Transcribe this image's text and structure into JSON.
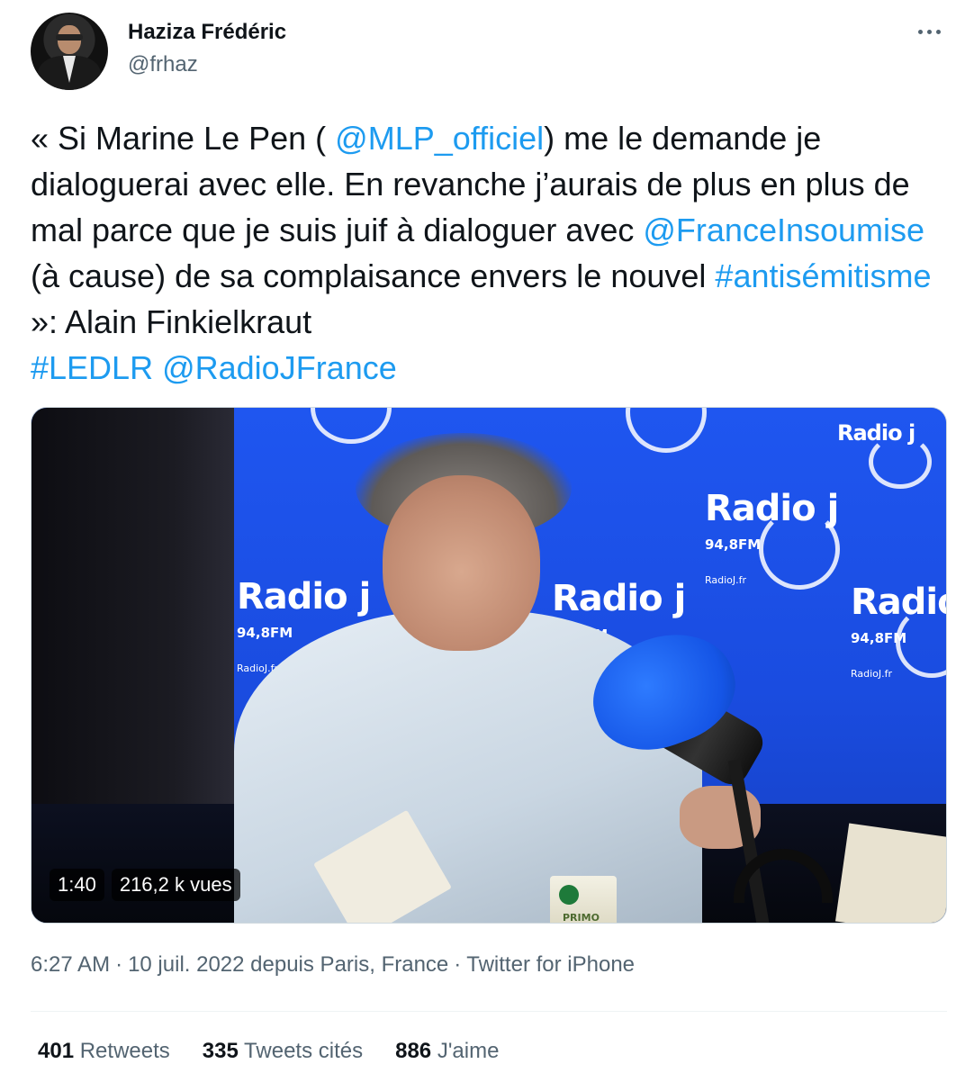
{
  "author": {
    "name": "Haziza Frédéric",
    "handle": "@frhaz"
  },
  "tweet": {
    "text_segments": [
      {
        "text": "« Si Marine Le Pen ( ",
        "type": "text"
      },
      {
        "text": "@MLP_officiel",
        "type": "mention"
      },
      {
        "text": ") me le demande je dialoguerai avec elle. En revanche j’aurais de plus en plus de mal parce que je suis juif à dialoguer avec ",
        "type": "text"
      },
      {
        "text": "@FranceInsoumise",
        "type": "mention"
      },
      {
        "text": " (à cause) de sa complaisance envers le nouvel ",
        "type": "text"
      },
      {
        "text": "#antisémitisme",
        "type": "hashtag"
      },
      {
        "text": " »: Alain Finkielkraut ",
        "type": "text"
      },
      {
        "text": "#LEDLR",
        "type": "hashtag"
      },
      {
        "text": " ",
        "type": "text"
      },
      {
        "text": "@RadioJFrance",
        "type": "mention"
      }
    ]
  },
  "media": {
    "duration": "1:40",
    "views": "216,2 k vues",
    "logos": {
      "brand": "Radio",
      "brand_letter": "j",
      "frequency": "94,8FM",
      "site": "RadioJ.fr"
    },
    "cup_label": "PRIMO"
  },
  "meta": {
    "time": "6:27 AM",
    "date": "10 juil. 2022 depuis Paris, France",
    "source": "Twitter for iPhone",
    "separator": "·"
  },
  "stats": [
    {
      "count": "401",
      "label": "Retweets"
    },
    {
      "count": "335",
      "label": "Tweets cités"
    },
    {
      "count": "886",
      "label": "J'aime"
    }
  ],
  "colors": {
    "link": "#1d9bf0",
    "text": "#0f1419",
    "secondary": "#536471"
  }
}
